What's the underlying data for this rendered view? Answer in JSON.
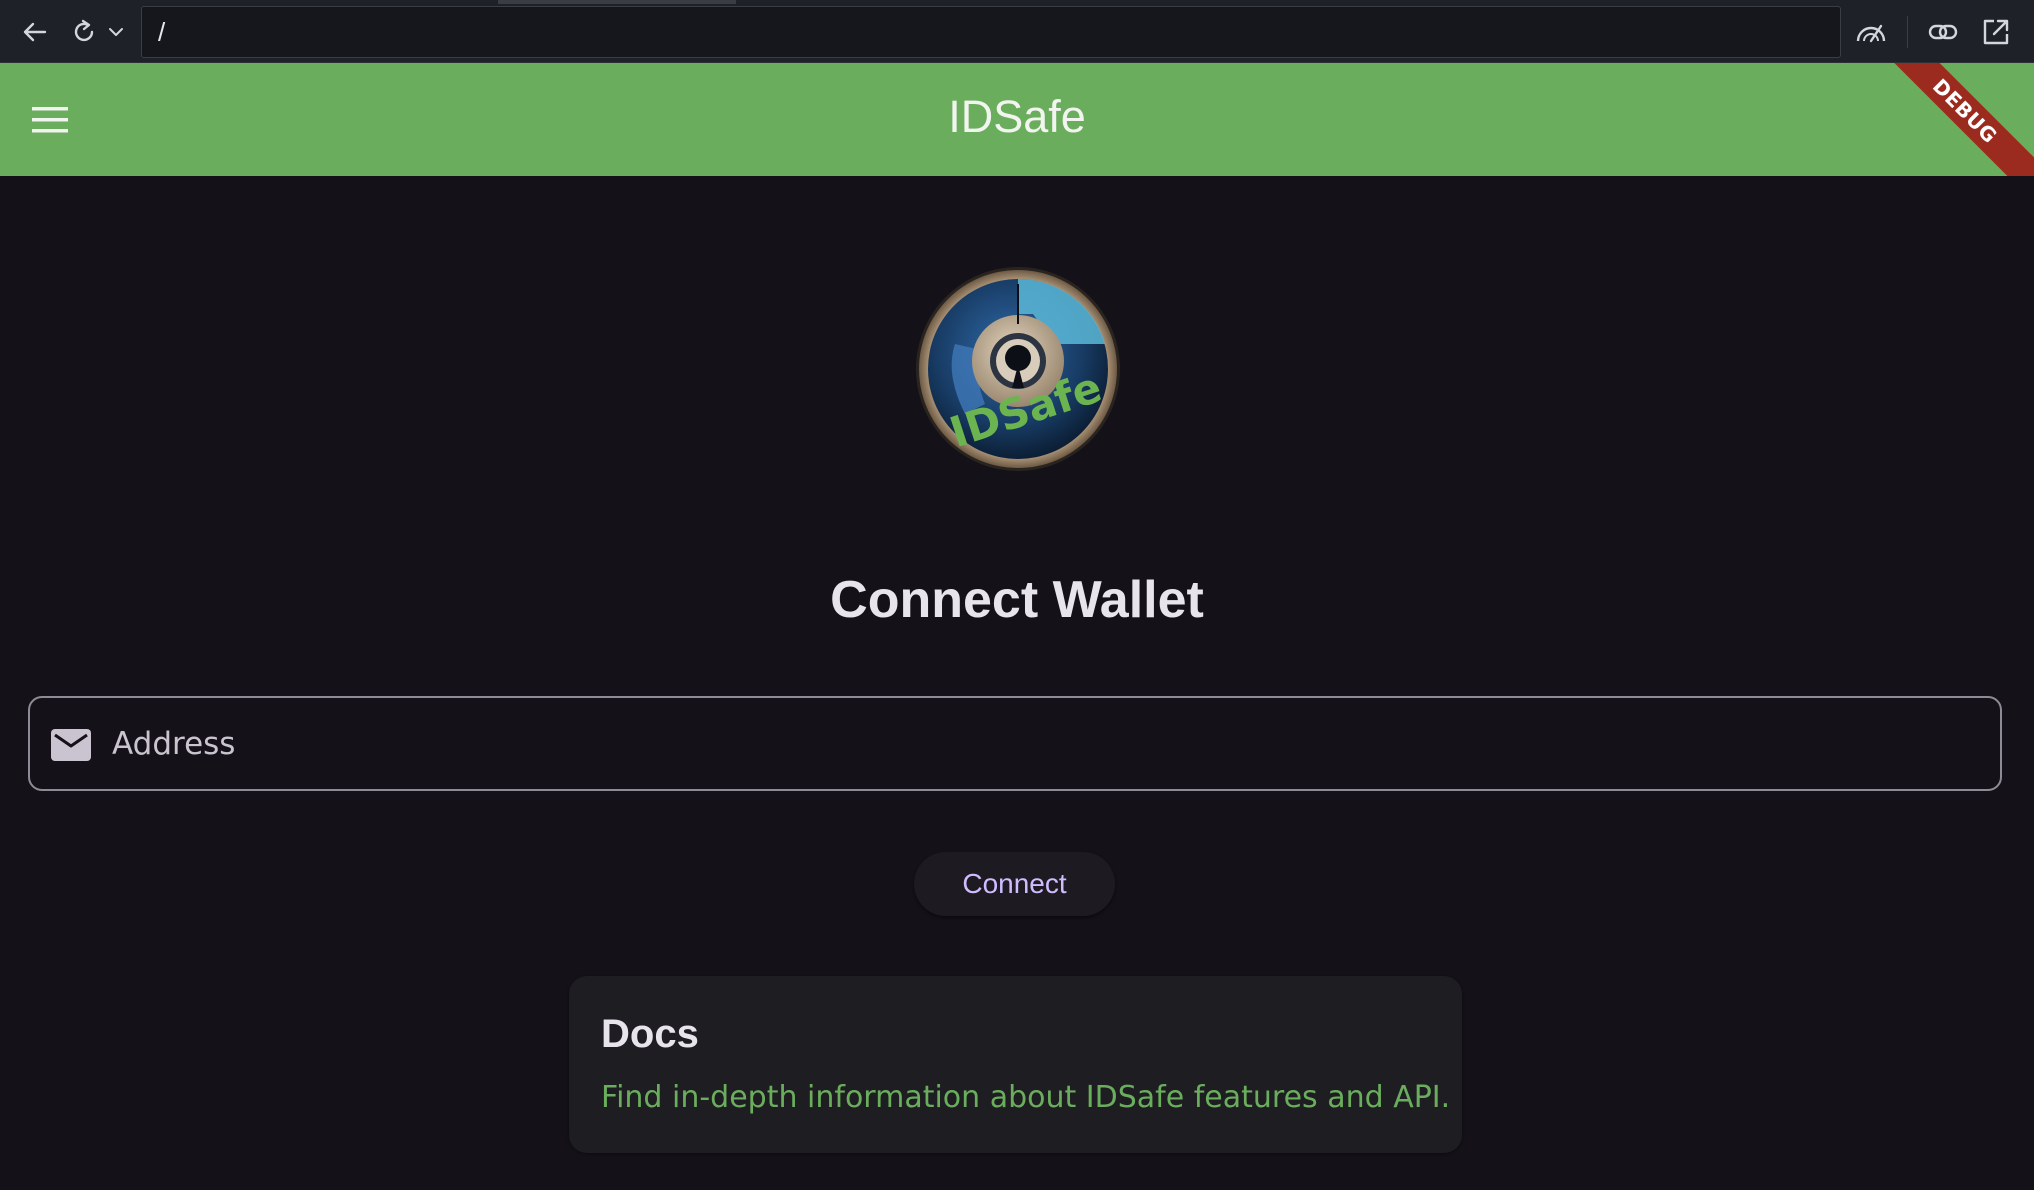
{
  "browser": {
    "url": "/",
    "icons": [
      "back-arrow-icon",
      "reload-icon",
      "chevron-down-icon",
      "performance-gauge-icon",
      "link-icon",
      "open-external-icon"
    ]
  },
  "app_bar": {
    "title": "IDSafe",
    "debug_label": "DEBUG",
    "background_color": "#6aad5d"
  },
  "logo": {
    "text": "IDSafe"
  },
  "main": {
    "heading": "Connect Wallet",
    "address_field": {
      "placeholder": "Address",
      "value": "",
      "icon": "mail-icon"
    },
    "connect_button": "Connect"
  },
  "docs_card": {
    "title": "Docs",
    "description": "Find in-depth information about IDSafe features and API.",
    "accent_color": "#6aad5d"
  }
}
